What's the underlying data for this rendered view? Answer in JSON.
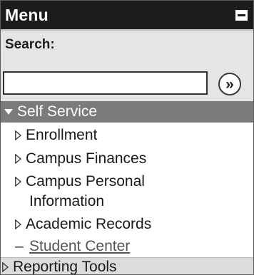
{
  "header": {
    "title": "Menu"
  },
  "search": {
    "label": "Search:",
    "value": "",
    "go_label": "»"
  },
  "self_service": {
    "label": "Self Service",
    "items": [
      {
        "label": "Enrollment"
      },
      {
        "label": "Campus Finances"
      },
      {
        "label_line1": "Campus Personal",
        "label_line2": "Information"
      },
      {
        "label": "Academic Records"
      },
      {
        "label": "Student Center"
      }
    ]
  },
  "reporting_tools": {
    "label": "Reporting Tools"
  }
}
